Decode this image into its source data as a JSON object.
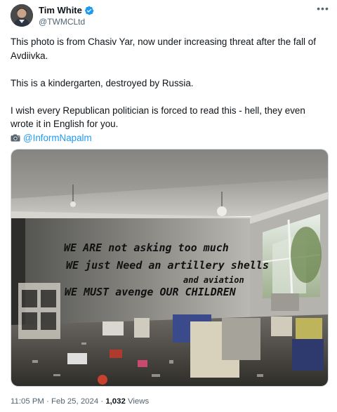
{
  "author": {
    "name": "Tim White",
    "handle": "@TWMCLtd",
    "verified": true,
    "avatar": "avatar-photo"
  },
  "more_icon": "ellipsis-icon",
  "tweet": {
    "line1": "This photo is from Chasiv Yar, now under increasing threat after the fall of Avdiivka.",
    "line2": "This is a kindergarten, destroyed by Russia.",
    "line3": "I wish every Republican politician is forced to read this - hell, they even wrote it in English for you.",
    "camera_icon": "camera-icon",
    "mention": "@InformNapalm"
  },
  "photo": {
    "wall_text": [
      "WE ARE not asking too much",
      "WE just Need an artillery shells",
      "and aviation",
      "WE MUST avenge OUR CHILDREN"
    ]
  },
  "meta": {
    "time": "11:05 PM",
    "separator": " · ",
    "date": "Feb 25, 2024",
    "views_count": "1,032",
    "views_label": "Views"
  },
  "colors": {
    "link": "#1d9bf0",
    "secondary_text": "#536471",
    "primary_text": "#0f1419"
  }
}
